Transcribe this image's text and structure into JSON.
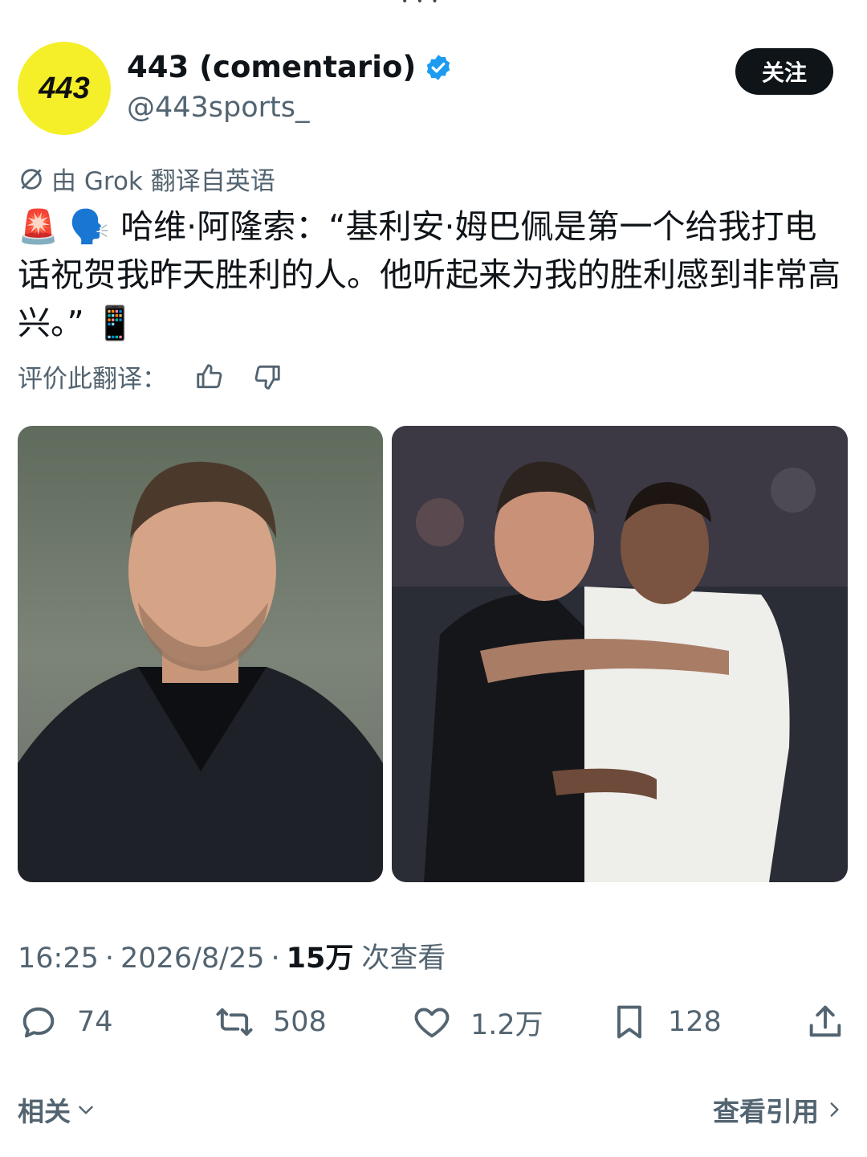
{
  "account": {
    "display_name": "443 (comentario)",
    "handle": "@443sports_",
    "avatar_logo_text": "443",
    "follow_label": "关注",
    "verified": true
  },
  "translation": {
    "label": "由 Grok 翻译自英语",
    "rate_label": "评价此翻译："
  },
  "tweet": {
    "text": "哈维·阿隆索：“基利安·姆巴佩是第一个给我打电话祝贺我昨天胜利的人。他听起来为我的胜利感到非常高兴。”",
    "leading_emojis": "🚨 🗣️",
    "trailing_emoji": "📱"
  },
  "meta": {
    "time": "16:25",
    "date": "2026/8/25",
    "views_count": "15万",
    "views_label": "次查看"
  },
  "actions": {
    "replies": "74",
    "reposts": "508",
    "likes": "1.2万",
    "bookmarks": "128"
  },
  "footer": {
    "related_label": "相关",
    "quotes_label": "查看引用"
  },
  "colors": {
    "avatar_bg": "#f5ef2a",
    "verified_blue": "#1d9bf0",
    "text_primary": "#0f1419",
    "text_secondary": "#536471"
  }
}
